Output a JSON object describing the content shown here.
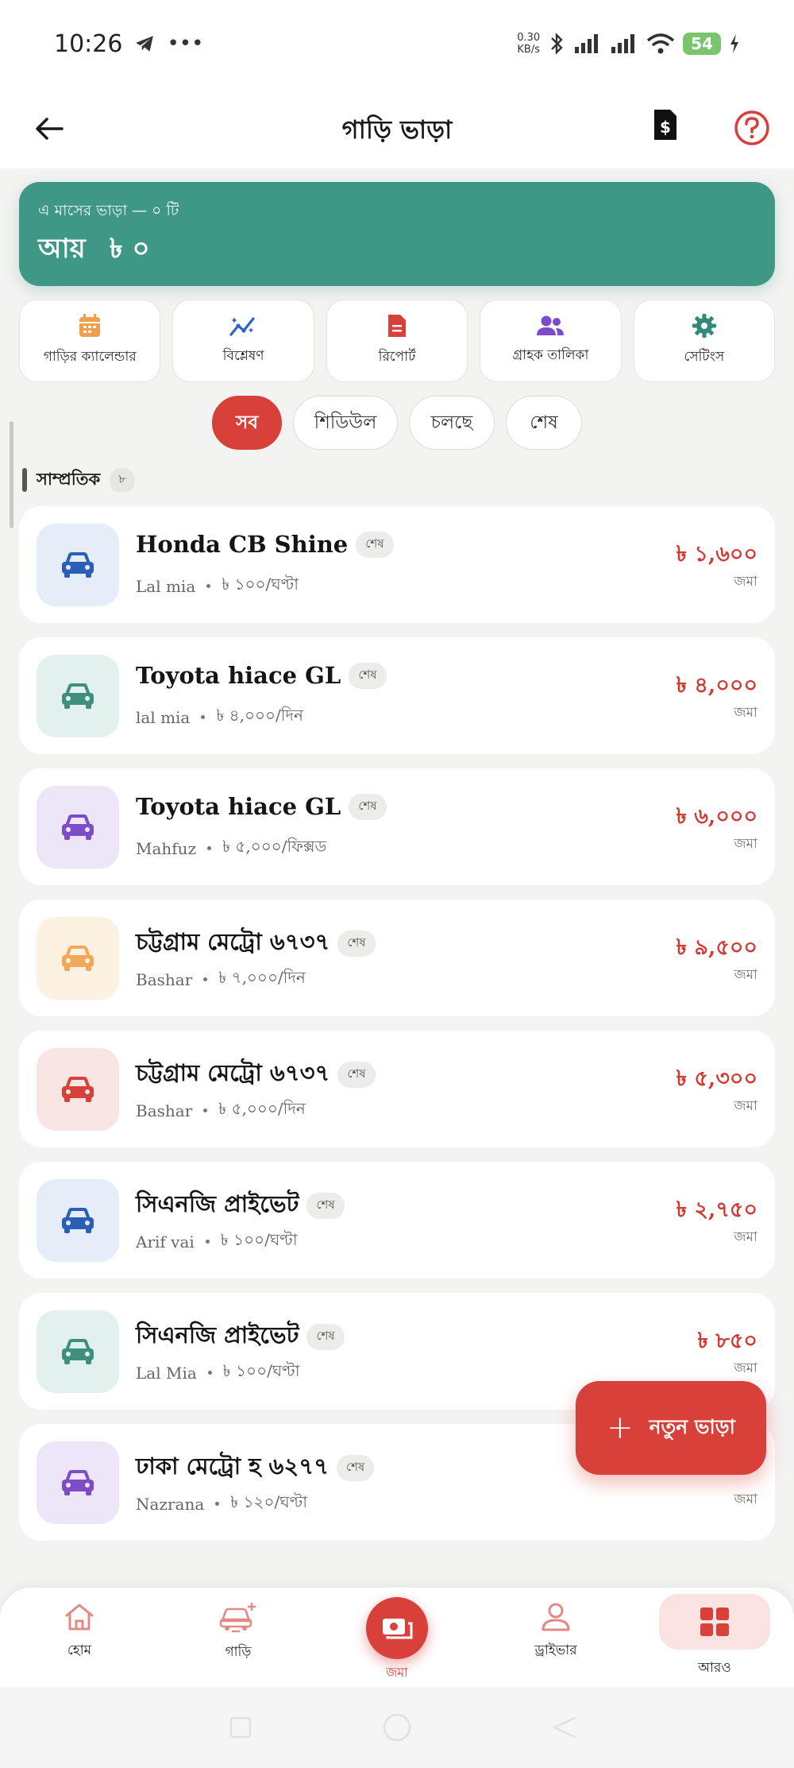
{
  "status_bar": {
    "time": "10:26",
    "netspeed_value": "0.30",
    "netspeed_unit": "KB/s",
    "battery": "54"
  },
  "header": {
    "title": "গাড়ি ভাড়া"
  },
  "summary": {
    "subtitle": "এ মাসের ভাড়া — ০ টি",
    "income_label": "আয়",
    "income_value": "৳ ০"
  },
  "quick_actions": [
    {
      "label": "গাড়ির ক্যালেন্ডার",
      "icon": "calendar-icon",
      "color": "#f0a04b"
    },
    {
      "label": "বিশ্লেষণ",
      "icon": "analytics-icon",
      "color": "#2f62c9"
    },
    {
      "label": "রিপোর্ট",
      "icon": "report-icon",
      "color": "#d8403a"
    },
    {
      "label": "গ্রাহক তালিকা",
      "icon": "customers-icon",
      "color": "#7d4cc7"
    },
    {
      "label": "সেটিংস",
      "icon": "gear-icon",
      "color": "#2f8a77"
    }
  ],
  "filters": [
    {
      "label": "সব",
      "active": true
    },
    {
      "label": "শিডিউল",
      "active": false
    },
    {
      "label": "চলছে",
      "active": false
    },
    {
      "label": "শেষ",
      "active": false
    }
  ],
  "section": {
    "title": "সাম্প্রতিক",
    "count": "৮"
  },
  "rentals": [
    {
      "title": "Honda CB Shine",
      "status": "শেষ",
      "customer": "Lal mia",
      "rate": "৳ ১০০/ঘণ্টা",
      "amount": "৳ ১,৬০০",
      "payment": "জমা",
      "icon_bg": "#e5edf8",
      "icon_color": "#2b5fb7"
    },
    {
      "title": "Toyota hiace GL",
      "status": "শেষ",
      "customer": "lal mia",
      "rate": "৳ ৪,০০০/দিন",
      "amount": "৳ ৪,০০০",
      "payment": "জমা",
      "icon_bg": "#e2f1ee",
      "icon_color": "#3f8f7e"
    },
    {
      "title": "Toyota hiace GL",
      "status": "শেষ",
      "customer": "Mahfuz",
      "rate": "৳ ৫,০০০/ফিক্সড",
      "amount": "৳ ৬,০০০",
      "payment": "জমা",
      "icon_bg": "#ece6f8",
      "icon_color": "#7d4cc7"
    },
    {
      "title": "চট্টগ্রাম মেট্রো ৬৭৩৭",
      "status": "শেষ",
      "customer": "Bashar",
      "rate": "৳ ৭,০০০/দিন",
      "amount": "৳ ৯,৫০০",
      "payment": "জমা",
      "icon_bg": "#fdf1e2",
      "icon_color": "#f2a85a"
    },
    {
      "title": "চট্টগ্রাম মেট্রো ৬৭৩৭",
      "status": "শেষ",
      "customer": "Bashar",
      "rate": "৳ ৫,০০০/দিন",
      "amount": "৳ ৫,৩০০",
      "payment": "জমা",
      "icon_bg": "#f8e5e4",
      "icon_color": "#d8403a"
    },
    {
      "title": "সিএনজি প্রাইভেট",
      "status": "শেষ",
      "customer": "Arif vai",
      "rate": "৳ ১০০/ঘণ্টা",
      "amount": "৳ ২,৭৫০",
      "payment": "জমা",
      "icon_bg": "#e5edf8",
      "icon_color": "#2b5fb7"
    },
    {
      "title": "সিএনজি প্রাইভেট",
      "status": "শেষ",
      "customer": "Lal Mia",
      "rate": "৳ ১০০/ঘণ্টা",
      "amount": "৳ ৮৫০",
      "payment": "জমা",
      "icon_bg": "#e2f1ee",
      "icon_color": "#3f8f7e"
    },
    {
      "title": "ঢাকা মেট্রো হ ৬২৭৭",
      "status": "শেষ",
      "customer": "Nazrana",
      "rate": "৳ ১২০/ঘণ্টা",
      "amount": "",
      "payment": "জমা",
      "icon_bg": "#ece6f8",
      "icon_color": "#7d4cc7"
    }
  ],
  "fab": {
    "label": "নতুন ভাড়া"
  },
  "bottom_nav": {
    "home": "হোম",
    "vehicles": "গাড়ি",
    "deposit": "জমা",
    "drivers": "ড্রাইভার",
    "more": "আরও"
  },
  "colors": {
    "accent_red": "#d8403a",
    "teal": "#3f9786"
  }
}
